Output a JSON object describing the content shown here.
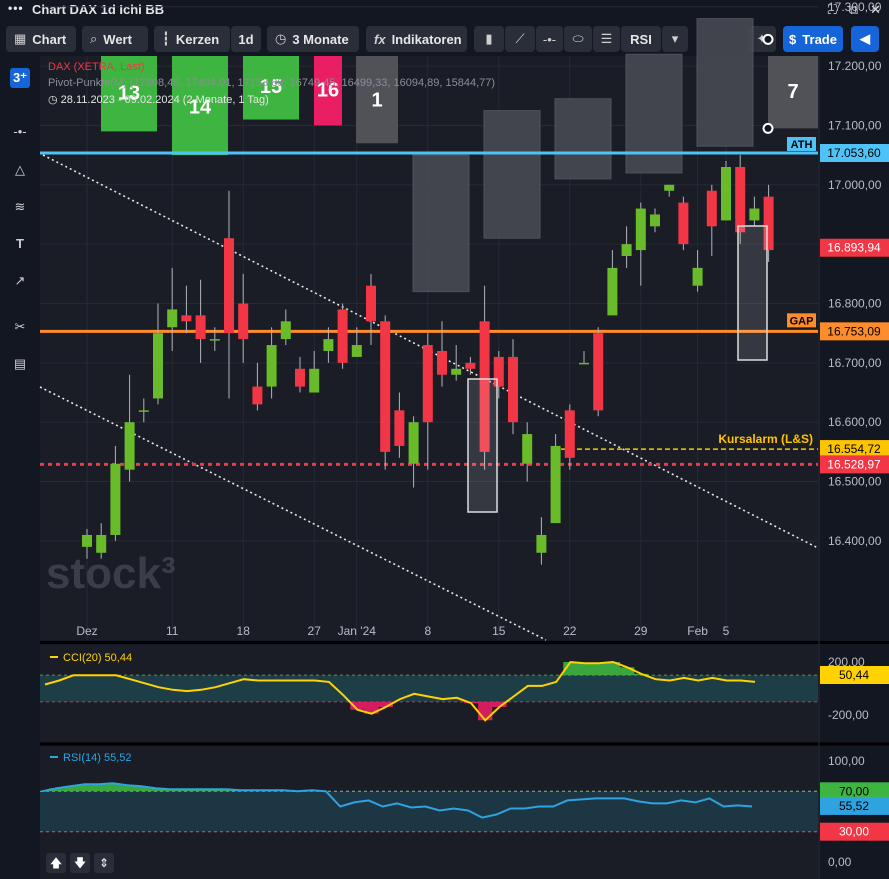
{
  "window": {
    "title": "Chart DAX 1d Ichi BB",
    "menu_icon": "dots-icon",
    "controls": [
      "expand-icon",
      "popout-icon",
      "close-icon"
    ]
  },
  "toolbar": {
    "chart_label": "Chart",
    "value_label": "Wert",
    "candles_label": "Kerzen",
    "interval_label": "1d",
    "range_label": "3 Monate",
    "indicators_label": "Indikatoren",
    "rsi_label": "RSI",
    "trade_label": "Trade"
  },
  "sidebar": {
    "badge": "3⁺",
    "tools": [
      "horizontal-line-icon",
      "triangle-icon",
      "fibonacci-icon",
      "text-icon",
      "arrow-icon",
      "scissors-icon",
      "list-icon"
    ]
  },
  "legend": {
    "instrument": "DAX (XETRA, Last)",
    "pivot": "Pivot-Punkte(M) (17808,45, 17404,01, 17153,89, 16749,45, 16499,33, 16094,89, 15844,77)",
    "period": "28.11.2023 - 09.02.2024 (2 Monate, 1 Tag)"
  },
  "watermark": "stock³",
  "colors": {
    "up": "#6abb2a",
    "down": "#f23645",
    "ath": "#4fc3f7",
    "gap": "#ff8c2a",
    "alarm": "#ffc400",
    "bg": "#131722"
  },
  "chart_data": [
    {
      "type": "candlestick",
      "title": "Chart DAX 1d Ichi BB",
      "y_ticks": [
        "17.300,00",
        "17.200,00",
        "17.100,00",
        "17.000,00",
        "16.900,00",
        "16.800,00",
        "16.700,00",
        "16.600,00",
        "16.500,00",
        "16.400,00"
      ],
      "ylim": [
        16360,
        17340
      ],
      "x_ticks": [
        {
          "label": "Dez",
          "i": 0
        },
        {
          "label": "11",
          "i": 6
        },
        {
          "label": "18",
          "i": 11
        },
        {
          "label": "27",
          "i": 16
        },
        {
          "label": "Jan '24",
          "i": 19
        },
        {
          "label": "8",
          "i": 24
        },
        {
          "label": "15",
          "i": 29
        },
        {
          "label": "22",
          "i": 34
        },
        {
          "label": "29",
          "i": 39
        },
        {
          "label": "Feb",
          "i": 43
        },
        {
          "label": "5",
          "i": 45
        }
      ],
      "candles": [
        [
          16390,
          16410,
          16370,
          16420
        ],
        [
          16380,
          16410,
          16370,
          16430
        ],
        [
          16410,
          16530,
          16400,
          16560
        ],
        [
          16520,
          16600,
          16500,
          16680
        ],
        [
          16620,
          16620,
          16600,
          16640
        ],
        [
          16640,
          16750,
          16630,
          16800
        ],
        [
          16760,
          16790,
          16720,
          16860
        ],
        [
          16780,
          16770,
          16750,
          16830
        ],
        [
          16780,
          16740,
          16700,
          16840
        ],
        [
          16740,
          16740,
          16720,
          16760
        ],
        [
          16910,
          16750,
          16640,
          16990
        ],
        [
          16800,
          16740,
          16700,
          16850
        ],
        [
          16660,
          16630,
          16620,
          16700
        ],
        [
          16660,
          16730,
          16640,
          16760
        ],
        [
          16740,
          16770,
          16730,
          16790
        ],
        [
          16690,
          16660,
          16650,
          16710
        ],
        [
          16650,
          16690,
          16650,
          16720
        ],
        [
          16720,
          16740,
          16700,
          16760
        ],
        [
          16790,
          16700,
          16690,
          16800
        ],
        [
          16710,
          16730,
          16710,
          16760
        ],
        [
          16830,
          16770,
          16730,
          16850
        ],
        [
          16770,
          16550,
          16520,
          16780
        ],
        [
          16620,
          16560,
          16540,
          16650
        ],
        [
          16530,
          16600,
          16490,
          16610
        ],
        [
          16730,
          16600,
          16520,
          16750
        ],
        [
          16720,
          16680,
          16660,
          16770
        ],
        [
          16680,
          16690,
          16670,
          16730
        ],
        [
          16700,
          16690,
          16680,
          16710
        ],
        [
          16770,
          16550,
          16520,
          16830
        ],
        [
          16710,
          16660,
          16640,
          16720
        ],
        [
          16710,
          16600,
          16580,
          16740
        ],
        [
          16530,
          16580,
          16500,
          16600
        ],
        [
          16380,
          16410,
          16360,
          16440
        ],
        [
          16430,
          16560,
          16430,
          16580
        ],
        [
          16620,
          16540,
          16520,
          16630
        ],
        [
          16700,
          16700,
          16700,
          16720
        ],
        [
          16750,
          16620,
          16610,
          16760
        ],
        [
          16780,
          16860,
          16780,
          16890
        ],
        [
          16880,
          16900,
          16860,
          16930
        ],
        [
          16890,
          16960,
          16830,
          16970
        ],
        [
          16930,
          16950,
          16920,
          16960
        ],
        [
          16990,
          17000,
          16980,
          17000
        ],
        [
          16970,
          16900,
          16890,
          16980
        ],
        [
          16830,
          16860,
          16820,
          16890
        ],
        [
          16990,
          16930,
          16880,
          17000
        ],
        [
          16940,
          17030,
          16940,
          17040
        ],
        [
          17030,
          16920,
          16900,
          17050
        ],
        [
          16940,
          16960,
          16930,
          16980
        ],
        [
          16980,
          16890,
          16870,
          17000
        ]
      ],
      "levels": [
        {
          "name": "ATH",
          "value": 17053.6,
          "label": "17.053,60",
          "color": "#4fc3f7"
        },
        {
          "name": "GAP",
          "value": 16753.09,
          "label": "16.753,09",
          "color": "#ff8c2a"
        },
        {
          "name": "Kursalarm (L&S)",
          "value": 16554.72,
          "label": "16.554,72",
          "color": "#ffc400"
        },
        {
          "name": "support",
          "value": 16528.97,
          "label": "16.528,97",
          "color": "#f23645"
        }
      ],
      "current_price": {
        "value": 16893.94,
        "label": "16.893,94"
      },
      "numbered_boxes": [
        {
          "label": "13",
          "color": "green",
          "top": 17240,
          "bottom": 17090
        },
        {
          "label": "14",
          "color": "green",
          "top": 17340,
          "bottom": 17050
        },
        {
          "label": "15",
          "color": "green",
          "top": 17340,
          "bottom": 17110
        },
        {
          "label": "16",
          "color": "red",
          "top": 17310,
          "bottom": 17100
        },
        {
          "label": "1",
          "color": "gray",
          "top": 17340,
          "bottom": 17070
        },
        {
          "label": "7",
          "color": "gray",
          "top": 17245,
          "bottom": 17095
        }
      ],
      "cloud_boxes": [
        [
          17050,
          16820
        ],
        [
          17125,
          16910
        ],
        [
          17145,
          17010
        ],
        [
          17220,
          17020
        ],
        [
          17280,
          17065
        ]
      ]
    },
    {
      "type": "line",
      "name": "CCI(20)",
      "last": "50,44",
      "y_ticks": [
        "200,00",
        "-200,00"
      ],
      "ylim": [
        -300,
        260
      ],
      "values": [
        30,
        60,
        100,
        100,
        100,
        100,
        70,
        40,
        10,
        -10,
        -20,
        -10,
        10,
        40,
        70,
        60,
        60,
        60,
        60,
        60,
        50,
        -50,
        -160,
        -190,
        -140,
        -80,
        -40,
        -60,
        -80,
        -70,
        -110,
        -240,
        -140,
        -60,
        20,
        20,
        50,
        200,
        190,
        190,
        200,
        160,
        110,
        70,
        60,
        80,
        60,
        80,
        60,
        60,
        50
      ]
    },
    {
      "type": "line",
      "name": "RSI(14)",
      "last": "55,52",
      "y_ticks": [
        "100,00",
        "70,00",
        "30,00",
        "0,00"
      ],
      "ylim": [
        -5,
        105
      ],
      "values": [
        70,
        73,
        75,
        77,
        77,
        78,
        76,
        75,
        73,
        72,
        72,
        72,
        72,
        72,
        71,
        71,
        71,
        71,
        70,
        71,
        70,
        55,
        59,
        61,
        55,
        58,
        54,
        55,
        51,
        53,
        51,
        44,
        47,
        53,
        53,
        55,
        55,
        61,
        62,
        63,
        63,
        63,
        60,
        58,
        58,
        61,
        59,
        63,
        55,
        56,
        55
      ]
    }
  ],
  "axis_tags": {
    "ath": "ATH",
    "gap": "GAP",
    "alarm": "Kursalarm (L&S)",
    "cci_last": "50,44",
    "rsi_70": "70,00",
    "rsi_last": "55,52",
    "rsi_30": "30,00"
  },
  "bottom_controls": [
    "move-up-icon",
    "move-down-icon",
    "collapse-icon"
  ]
}
